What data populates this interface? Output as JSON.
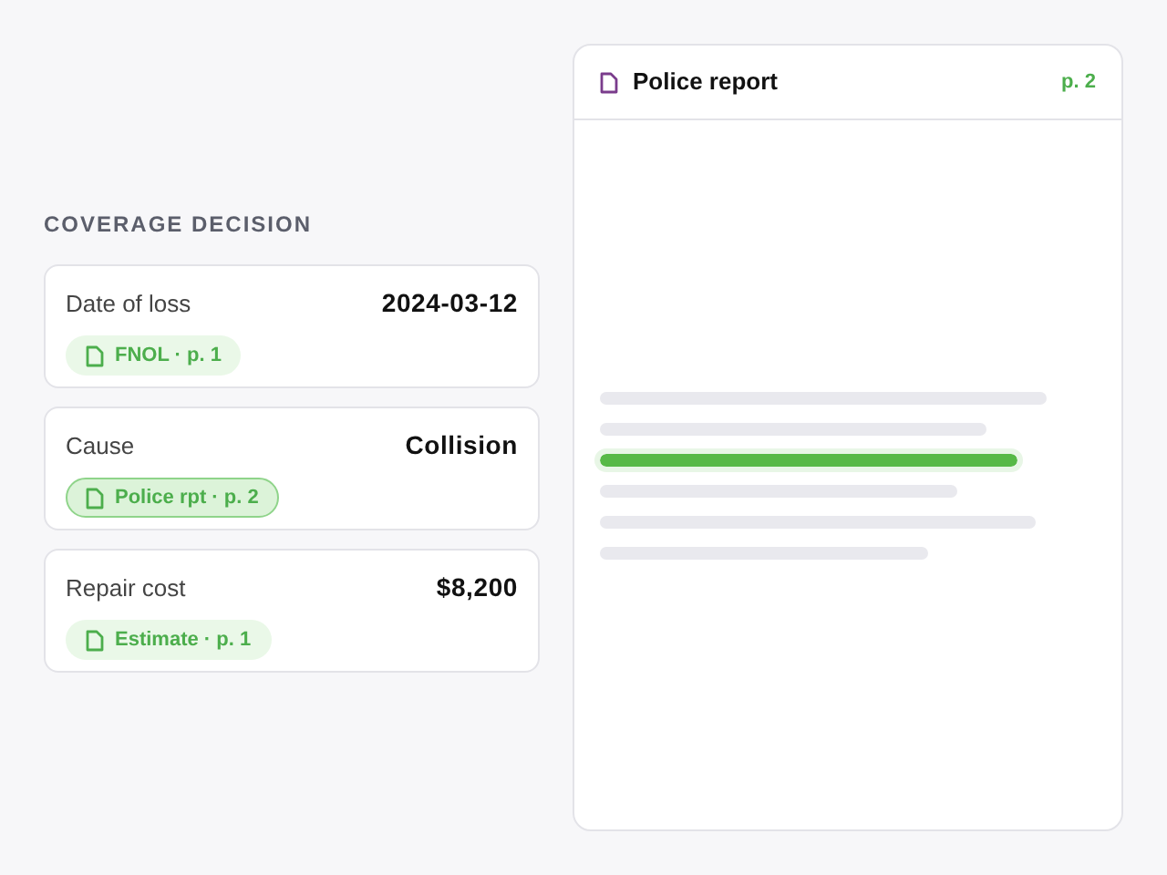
{
  "section_title": "COVERAGE DECISION",
  "fields": [
    {
      "label": "Date of loss",
      "value": "2024-03-12",
      "citation": "FNOL · p. 1",
      "selected": false
    },
    {
      "label": "Cause",
      "value": "Collision",
      "citation": "Police rpt · p. 2",
      "selected": true
    },
    {
      "label": "Repair cost",
      "value": "$8,200",
      "citation": "Estimate · p. 1",
      "selected": false
    }
  ],
  "document": {
    "title": "Police report",
    "page": "p. 2",
    "lines": [
      {
        "highlighted": false
      },
      {
        "highlighted": false
      },
      {
        "highlighted": true
      },
      {
        "highlighted": false
      },
      {
        "highlighted": false
      },
      {
        "highlighted": false
      }
    ]
  }
}
